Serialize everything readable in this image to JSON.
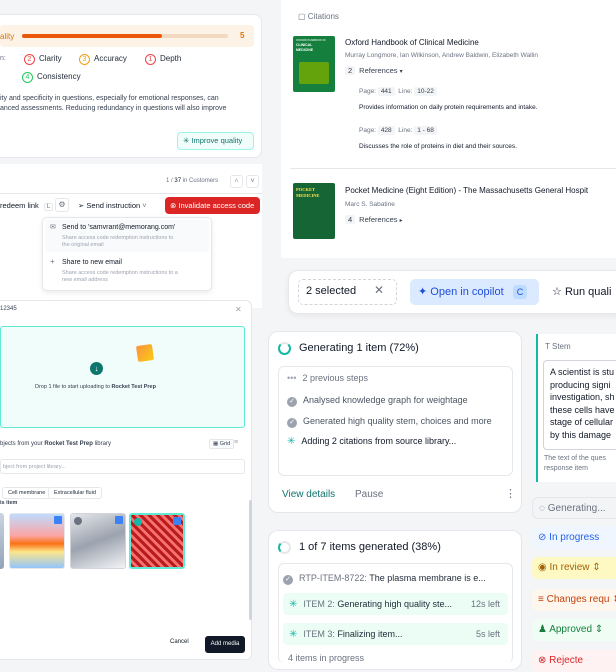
{
  "quality": {
    "label": "ality",
    "score": "5",
    "fill_fraction": 0.68,
    "prefix": "n:",
    "criteria": [
      {
        "num": "2",
        "label": "Clarity",
        "color": "#ef4444"
      },
      {
        "num": "3",
        "label": "Accuracy",
        "color": "#f59e0b"
      },
      {
        "num": "1",
        "label": "Depth",
        "color": "#ef4444"
      },
      {
        "num": "4",
        "label": "Consistency",
        "color": "#22c55e"
      }
    ],
    "text_line1": "ity and specificity in questions, especially for emotional responses, can",
    "text_line2": "anced assessments. Reducing redundancy in questions will also improve",
    "improve_button": "Improve quality"
  },
  "customers": {
    "pagination_current": "1",
    "pagination_sep": "/",
    "pagination_total": "37",
    "pagination_suffix": "in Customers",
    "redeem_label": "redeem link",
    "redeem_shortcut": "L",
    "send_instruction": "Send instruction",
    "invalidate": "Invalidate access code"
  },
  "send_menu": {
    "items": [
      {
        "title": "Send to 'samvrant@memorang.com'",
        "desc_line1": "Share access code redemption instructions to",
        "desc_line2": "the original email"
      },
      {
        "title": "Share to new email",
        "desc_line1": "Share access code redemption instructions to a",
        "desc_line2": "new email address"
      }
    ]
  },
  "upload": {
    "id": "12345",
    "drop_prefix": "Drop 1 file to start uploading to ",
    "drop_target": "Rocket Test Prep",
    "library_line_pre": "bjects from your ",
    "library_line_bold": "Rocket Test Prep",
    "library_line_post": " library",
    "view_mode": "Grid",
    "search_placeholder": "bject from project library...",
    "chips": [
      "Cell membrane",
      "Extracellular fluid"
    ],
    "section_label": "is item",
    "cancel": "Cancel",
    "add_media": "Add media"
  },
  "citations": {
    "header": "Citations",
    "books": [
      {
        "title": "Oxford Handbook of Clinical Medicine",
        "authors": "Murray Longmore, Ian Wilkinson, Andrew Baldwin, Elizabeth Wallin",
        "ref_count": "2",
        "ref_label": "References",
        "cover_title_line1": "OXFORD HANDBOOK OF",
        "cover_title_line2": "CLINICAL",
        "cover_title_line3": "MEDICINE"
      },
      {
        "title": "Pocket Medicine (Eight Edition) - The Massachusetts General Hospit",
        "authors": "Marc S. Sabatine",
        "ref_count": "4",
        "ref_label": "References",
        "cover_title_line1": "POCKET",
        "cover_title_line2": "MEDICINE"
      }
    ],
    "refs": [
      {
        "page_label": "Page:",
        "page": "441",
        "line_label": "Line:",
        "line": "10-22",
        "text": "Provides information on daily protein requirements and intake."
      },
      {
        "page_label": "Page:",
        "page": "428",
        "line_label": "Line:",
        "line": "1 - 68",
        "text": "Discusses the role of proteins in diet and their sources."
      }
    ]
  },
  "selection_bar": {
    "count": "2 selected",
    "open_copilot": "Open in copilot",
    "copilot_key": "C",
    "run_quality": "Run quali"
  },
  "generating": {
    "title": "Generating 1 item (72%)",
    "steps": [
      {
        "state": "dots",
        "text": "2 previous steps"
      },
      {
        "state": "done",
        "text": "Analysed knowledge graph for weightage"
      },
      {
        "state": "done",
        "text": "Generated high quality stem, choices and more"
      },
      {
        "state": "spin",
        "text": "Adding 2 citations from source library..."
      }
    ],
    "view_details": "View details",
    "pause": "Pause"
  },
  "items_generated": {
    "title": "1 of 7 items generated (38%)",
    "rows": [
      {
        "state": "done",
        "label": "RTP-ITEM-8722:",
        "text": "The plasma membrane is e...",
        "time": ""
      },
      {
        "state": "spin",
        "label": "ITEM 2:",
        "text": "Generating high quality ste...",
        "time": "12s left"
      },
      {
        "state": "spin",
        "label": "ITEM 3:",
        "text": "Finalizing item...",
        "time": "5s left"
      }
    ],
    "more": "4 items in progress"
  },
  "stem": {
    "header": "Stem",
    "lines": [
      "A scientist is stu",
      "producing signi",
      "investigation, sh",
      "these cells have",
      "stage of cellular",
      "by this damage"
    ],
    "hint_line1": "The text of the ques",
    "hint_line2": "response item"
  },
  "status_pills": [
    {
      "label": "Generating...",
      "bg": "#f3f4f6",
      "fg": "#6b7280"
    },
    {
      "label": "In progress",
      "bg": "#eff6ff",
      "fg": "#2563eb"
    },
    {
      "label": "In review",
      "bg": "#fef9c3",
      "fg": "#a16207"
    },
    {
      "label": "Changes requ",
      "bg": "#fff7ed",
      "fg": "#c2410c"
    },
    {
      "label": "Approved",
      "bg": "#f0fdf4",
      "fg": "#15803d"
    },
    {
      "label": "Rejecte",
      "bg": "#fef2f2",
      "fg": "#dc2626"
    }
  ]
}
